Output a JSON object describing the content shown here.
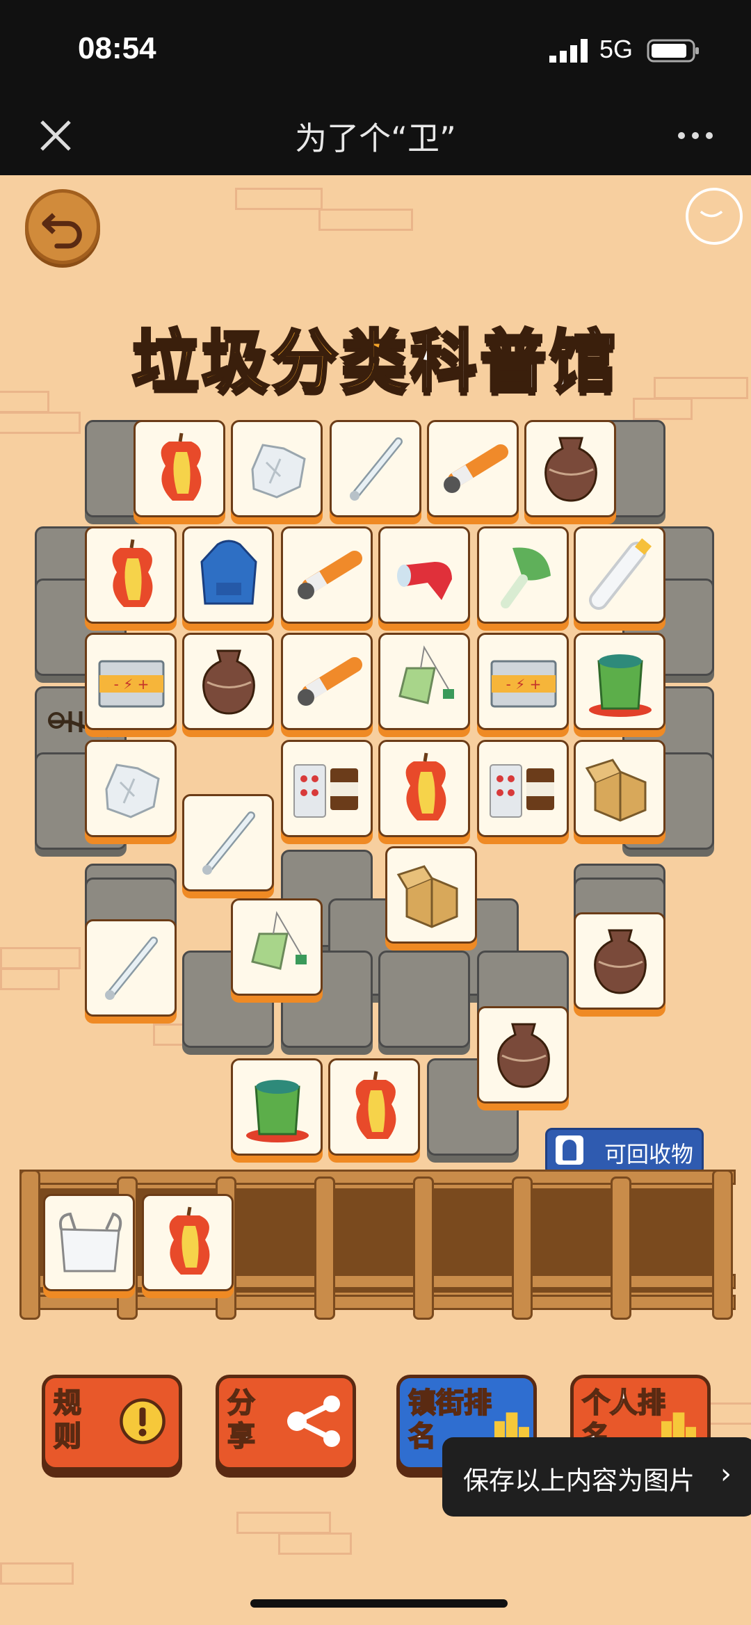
{
  "status_bar": {
    "time": "08:54",
    "network": "5G"
  },
  "nav": {
    "title": "为了个“卫”"
  },
  "game": {
    "title_part1": "垃圾分类",
    "title_part2": "科普馆",
    "recycle_button": "可回收物",
    "board_tiles": [
      "apple-core",
      "tissue",
      "thermometer",
      "cigarette",
      "pottery-jar",
      "apple-core",
      "hoodie",
      "cigarette",
      "plastic-tube",
      "cabbage",
      "plastic-bottle",
      "battery",
      "pottery-jar",
      "cigarette",
      "tea-bag",
      "battery",
      "paint-bucket",
      "tissue",
      "medicine",
      "apple-core",
      "medicine",
      "cardboard-box",
      "thermometer",
      "cardboard-box",
      "thermometer",
      "tea-bag",
      "pottery-jar",
      "pottery-jar",
      "paint-bucket",
      "apple-core"
    ],
    "slot_tiles": [
      "plastic-bag",
      "apple-core"
    ],
    "buttons": {
      "rules": "规则",
      "share": "分享",
      "street_rank": "镇街排名",
      "personal_rank": "个人排名"
    }
  },
  "toast": {
    "text": "保存以上内容为图片"
  }
}
